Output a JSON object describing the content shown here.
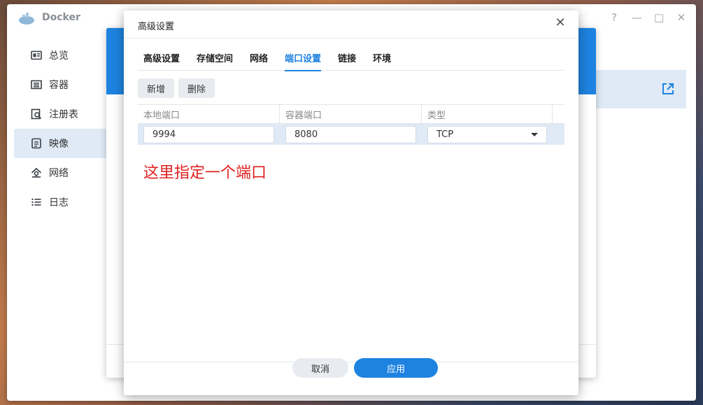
{
  "app": {
    "title": "Docker"
  },
  "window_controls": {
    "help": "?",
    "minimize": "—",
    "maximize": "□",
    "close": "✕"
  },
  "sidebar": {
    "items": [
      {
        "label": "总览",
        "icon": "overview-icon"
      },
      {
        "label": "容器",
        "icon": "container-icon"
      },
      {
        "label": "注册表",
        "icon": "registry-icon"
      },
      {
        "label": "映像",
        "icon": "image-icon",
        "active": true
      },
      {
        "label": "网络",
        "icon": "network-icon"
      },
      {
        "label": "日志",
        "icon": "log-icon"
      }
    ]
  },
  "modal": {
    "title": "高级设置",
    "close": "✕",
    "tabs": [
      "高级设置",
      "存储空间",
      "网络",
      "端口设置",
      "链接",
      "环境"
    ],
    "active_tab": "端口设置",
    "toolbar": {
      "add_label": "新增",
      "delete_label": "删除"
    },
    "grid": {
      "headers": [
        "本地端口",
        "容器端口",
        "类型"
      ],
      "rows": [
        {
          "local_port": "9994",
          "container_port": "8080",
          "type": "TCP"
        }
      ]
    },
    "annotation": "这里指定一个端口",
    "footer": {
      "cancel_label": "取消",
      "apply_label": "应用"
    }
  },
  "colors": {
    "accent": "#1e83e0",
    "selection": "#dfeaf6",
    "annotation": "#e02020"
  }
}
